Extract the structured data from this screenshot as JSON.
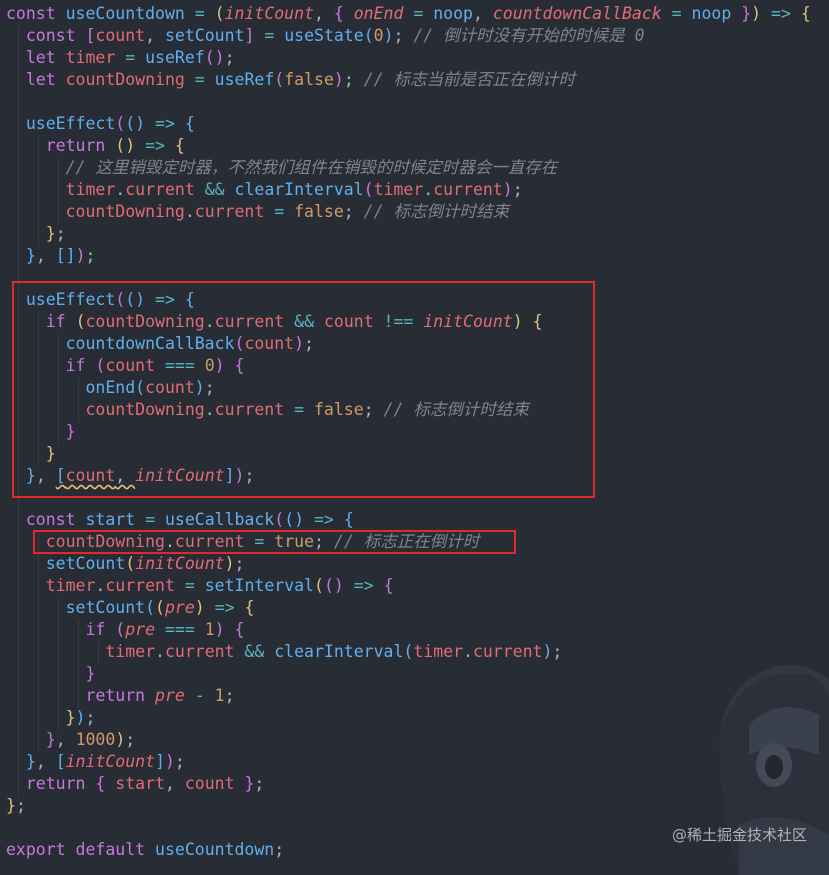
{
  "code": {
    "lines": [
      [
        [
          "kw",
          "const "
        ],
        [
          "fn",
          "useCountdown"
        ],
        [
          "op",
          " = "
        ],
        [
          "p1",
          "("
        ],
        [
          "pm",
          "initCount"
        ],
        [
          "pn",
          ", "
        ],
        [
          "p2",
          "{ "
        ],
        [
          "pm",
          "onEnd"
        ],
        [
          "op",
          " = "
        ],
        [
          "fn",
          "noop"
        ],
        [
          "pn",
          ", "
        ],
        [
          "pm",
          "countdownCallBack"
        ],
        [
          "op",
          " = "
        ],
        [
          "fn",
          "noop"
        ],
        [
          "p2",
          " }"
        ],
        [
          "p1",
          ")"
        ],
        [
          "op",
          " => "
        ],
        [
          "p1",
          "{"
        ]
      ],
      [
        [
          "pn",
          "  "
        ],
        [
          "kw",
          "const "
        ],
        [
          "p2",
          "["
        ],
        [
          "var",
          "count"
        ],
        [
          "pn",
          ", "
        ],
        [
          "fn",
          "setCount"
        ],
        [
          "p2",
          "]"
        ],
        [
          "op",
          " = "
        ],
        [
          "fn",
          "useState"
        ],
        [
          "p3",
          "("
        ],
        [
          "num",
          "0"
        ],
        [
          "p3",
          ")"
        ],
        [
          "pn",
          "; "
        ],
        [
          "cm",
          "// 倒计时没有开始的时候是 0"
        ]
      ],
      [
        [
          "pn",
          "  "
        ],
        [
          "kw",
          "let "
        ],
        [
          "var",
          "timer"
        ],
        [
          "op",
          " = "
        ],
        [
          "fn",
          "useRef"
        ],
        [
          "p2",
          "()"
        ],
        [
          "pn",
          ";"
        ]
      ],
      [
        [
          "pn",
          "  "
        ],
        [
          "kw",
          "let "
        ],
        [
          "var",
          "countDowning"
        ],
        [
          "op",
          " = "
        ],
        [
          "fn",
          "useRef"
        ],
        [
          "p2",
          "("
        ],
        [
          "bool",
          "false"
        ],
        [
          "p2",
          ")"
        ],
        [
          "pn",
          "; "
        ],
        [
          "cm",
          "// 标志当前是否正在倒计时"
        ]
      ],
      [],
      [
        [
          "pn",
          "  "
        ],
        [
          "fn",
          "useEffect"
        ],
        [
          "p2",
          "("
        ],
        [
          "p3",
          "()"
        ],
        [
          "op",
          " => "
        ],
        [
          "p3",
          "{"
        ]
      ],
      [
        [
          "pn",
          "    "
        ],
        [
          "kw",
          "return "
        ],
        [
          "p1",
          "()"
        ],
        [
          "op",
          " => "
        ],
        [
          "p1",
          "{"
        ]
      ],
      [
        [
          "pn",
          "      "
        ],
        [
          "cm",
          "// 这里销毁定时器，不然我们组件在销毁的时候定时器会一直存在"
        ]
      ],
      [
        [
          "pn",
          "      "
        ],
        [
          "var",
          "timer"
        ],
        [
          "pn",
          "."
        ],
        [
          "var",
          "current"
        ],
        [
          "op",
          " && "
        ],
        [
          "fn",
          "clearInterval"
        ],
        [
          "p2",
          "("
        ],
        [
          "var",
          "timer"
        ],
        [
          "pn",
          "."
        ],
        [
          "var",
          "current"
        ],
        [
          "p2",
          ")"
        ],
        [
          "pn",
          ";"
        ]
      ],
      [
        [
          "pn",
          "      "
        ],
        [
          "var",
          "countDowning"
        ],
        [
          "pn",
          "."
        ],
        [
          "var",
          "current"
        ],
        [
          "op",
          " = "
        ],
        [
          "bool",
          "false"
        ],
        [
          "pn",
          "; "
        ],
        [
          "cm",
          "// 标志倒计时结束"
        ]
      ],
      [
        [
          "pn",
          "    "
        ],
        [
          "p1",
          "}"
        ],
        [
          "pn",
          ";"
        ]
      ],
      [
        [
          "pn",
          "  "
        ],
        [
          "p3",
          "}"
        ],
        [
          "pn",
          ", "
        ],
        [
          "p3",
          "[]"
        ],
        [
          "p2",
          ")"
        ],
        [
          "pn",
          ";"
        ]
      ],
      [],
      [
        [
          "pn",
          "  "
        ],
        [
          "fn",
          "useEffect"
        ],
        [
          "p2",
          "("
        ],
        [
          "p3",
          "()"
        ],
        [
          "op",
          " => "
        ],
        [
          "p3",
          "{"
        ]
      ],
      [
        [
          "pn",
          "    "
        ],
        [
          "kw",
          "if "
        ],
        [
          "p1",
          "("
        ],
        [
          "var",
          "countDowning"
        ],
        [
          "pn",
          "."
        ],
        [
          "var",
          "current"
        ],
        [
          "op",
          " && "
        ],
        [
          "var",
          "count"
        ],
        [
          "op",
          " !== "
        ],
        [
          "pm",
          "initCount"
        ],
        [
          "p1",
          ")"
        ],
        [
          "pn",
          " "
        ],
        [
          "p1",
          "{"
        ]
      ],
      [
        [
          "pn",
          "      "
        ],
        [
          "fn",
          "countdownCallBack"
        ],
        [
          "p2",
          "("
        ],
        [
          "var",
          "count"
        ],
        [
          "p2",
          ")"
        ],
        [
          "pn",
          ";"
        ]
      ],
      [
        [
          "pn",
          "      "
        ],
        [
          "kw",
          "if "
        ],
        [
          "p2",
          "("
        ],
        [
          "var",
          "count"
        ],
        [
          "op",
          " === "
        ],
        [
          "num",
          "0"
        ],
        [
          "p2",
          ")"
        ],
        [
          "pn",
          " "
        ],
        [
          "p2",
          "{"
        ]
      ],
      [
        [
          "pn",
          "        "
        ],
        [
          "fn",
          "onEnd"
        ],
        [
          "p3",
          "("
        ],
        [
          "var",
          "count"
        ],
        [
          "p3",
          ")"
        ],
        [
          "pn",
          ";"
        ]
      ],
      [
        [
          "pn",
          "        "
        ],
        [
          "var",
          "countDowning"
        ],
        [
          "pn",
          "."
        ],
        [
          "var",
          "current"
        ],
        [
          "op",
          " = "
        ],
        [
          "bool",
          "false"
        ],
        [
          "pn",
          "; "
        ],
        [
          "cm",
          "// 标志倒计时结束"
        ]
      ],
      [
        [
          "pn",
          "      "
        ],
        [
          "p2",
          "}"
        ]
      ],
      [
        [
          "pn",
          "    "
        ],
        [
          "p1",
          "}"
        ]
      ],
      [
        [
          "pn",
          "  "
        ],
        [
          "p3",
          "}"
        ],
        [
          "pn",
          ", "
        ],
        [
          "p3",
          "["
        ],
        [
          "var",
          "count"
        ],
        [
          "pn",
          ", "
        ],
        [
          "pm",
          "initCount"
        ],
        [
          "p3",
          "]"
        ],
        [
          "p2",
          ")"
        ],
        [
          "pn",
          ";"
        ]
      ],
      [],
      [
        [
          "pn",
          "  "
        ],
        [
          "kw",
          "const "
        ],
        [
          "fn",
          "start"
        ],
        [
          "op",
          " = "
        ],
        [
          "fn",
          "useCallback"
        ],
        [
          "p2",
          "("
        ],
        [
          "p3",
          "()"
        ],
        [
          "op",
          " => "
        ],
        [
          "p3",
          "{"
        ]
      ],
      [
        [
          "pn",
          "    "
        ],
        [
          "var",
          "countDowning"
        ],
        [
          "pn",
          "."
        ],
        [
          "var",
          "current"
        ],
        [
          "op",
          " = "
        ],
        [
          "bool",
          "true"
        ],
        [
          "pn",
          "; "
        ],
        [
          "cm",
          "// 标志正在倒计时"
        ]
      ],
      [
        [
          "pn",
          "    "
        ],
        [
          "fn",
          "setCount"
        ],
        [
          "p1",
          "("
        ],
        [
          "pm",
          "initCount"
        ],
        [
          "p1",
          ")"
        ],
        [
          "pn",
          ";"
        ]
      ],
      [
        [
          "pn",
          "    "
        ],
        [
          "var",
          "timer"
        ],
        [
          "pn",
          "."
        ],
        [
          "var",
          "current"
        ],
        [
          "op",
          " = "
        ],
        [
          "fn",
          "setInterval"
        ],
        [
          "p1",
          "("
        ],
        [
          "p2",
          "()"
        ],
        [
          "op",
          " => "
        ],
        [
          "p2",
          "{"
        ]
      ],
      [
        [
          "pn",
          "      "
        ],
        [
          "fn",
          "setCount"
        ],
        [
          "p3",
          "("
        ],
        [
          "p1",
          "("
        ],
        [
          "pm",
          "pre"
        ],
        [
          "p1",
          ")"
        ],
        [
          "op",
          " => "
        ],
        [
          "p1",
          "{"
        ]
      ],
      [
        [
          "pn",
          "        "
        ],
        [
          "kw",
          "if "
        ],
        [
          "p2",
          "("
        ],
        [
          "pm",
          "pre"
        ],
        [
          "op",
          " === "
        ],
        [
          "num",
          "1"
        ],
        [
          "p2",
          ")"
        ],
        [
          "pn",
          " "
        ],
        [
          "p2",
          "{"
        ]
      ],
      [
        [
          "pn",
          "          "
        ],
        [
          "var",
          "timer"
        ],
        [
          "pn",
          "."
        ],
        [
          "var",
          "current"
        ],
        [
          "op",
          " && "
        ],
        [
          "fn",
          "clearInterval"
        ],
        [
          "p3",
          "("
        ],
        [
          "var",
          "timer"
        ],
        [
          "pn",
          "."
        ],
        [
          "var",
          "current"
        ],
        [
          "p3",
          ")"
        ],
        [
          "pn",
          ";"
        ]
      ],
      [
        [
          "pn",
          "        "
        ],
        [
          "p2",
          "}"
        ]
      ],
      [
        [
          "pn",
          "        "
        ],
        [
          "kw",
          "return "
        ],
        [
          "pm",
          "pre"
        ],
        [
          "op",
          " - "
        ],
        [
          "num",
          "1"
        ],
        [
          "pn",
          ";"
        ]
      ],
      [
        [
          "pn",
          "      "
        ],
        [
          "p1",
          "}"
        ],
        [
          "p3",
          ")"
        ],
        [
          "pn",
          ";"
        ]
      ],
      [
        [
          "pn",
          "    "
        ],
        [
          "p2",
          "}"
        ],
        [
          "pn",
          ", "
        ],
        [
          "num",
          "1000"
        ],
        [
          "p1",
          ")"
        ],
        [
          "pn",
          ";"
        ]
      ],
      [
        [
          "pn",
          "  "
        ],
        [
          "p3",
          "}"
        ],
        [
          "pn",
          ", "
        ],
        [
          "p3",
          "["
        ],
        [
          "pm",
          "initCount"
        ],
        [
          "p3",
          "]"
        ],
        [
          "p2",
          ")"
        ],
        [
          "pn",
          ";"
        ]
      ],
      [
        [
          "pn",
          "  "
        ],
        [
          "kw",
          "return "
        ],
        [
          "p2",
          "{ "
        ],
        [
          "var",
          "start"
        ],
        [
          "pn",
          ", "
        ],
        [
          "var",
          "count"
        ],
        [
          "p2",
          " }"
        ],
        [
          "pn",
          ";"
        ]
      ],
      [
        [
          "p1",
          "}"
        ],
        [
          "pn",
          ";"
        ]
      ],
      [],
      [
        [
          "kw",
          "export "
        ],
        [
          "kw",
          "default "
        ],
        [
          "fn",
          "useCountdown"
        ],
        [
          "pn",
          ";"
        ]
      ]
    ]
  },
  "watermark": "@稀土掘金技术社区",
  "colors": {
    "background": "#282c34",
    "highlight_box": "#e3272b"
  }
}
